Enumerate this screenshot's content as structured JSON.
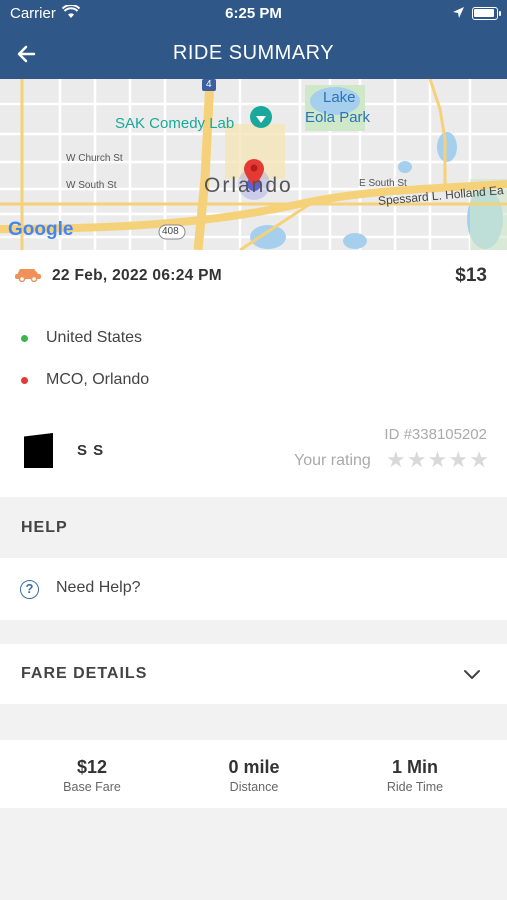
{
  "status_bar": {
    "carrier": "Carrier",
    "time": "6:25 PM"
  },
  "nav": {
    "title": "RIDE SUMMARY",
    "back_icon": "back-arrow-icon"
  },
  "map": {
    "labels": {
      "lake": "Lake",
      "eola_park": "Eola Park",
      "sak": "SAK Comedy Lab",
      "church": "W Church St",
      "south": "W South St",
      "e_south": "E South St",
      "orlando": "Orlando",
      "spessard": "Spessard L. Holland Ea",
      "route_408": "408",
      "route_4": "4",
      "google": "Google"
    }
  },
  "ride": {
    "date": "22 Feb, 2022 06:24 PM",
    "price": "$13",
    "pickup": "United States",
    "dropoff": "MCO, Orlando",
    "driver_name": "S S",
    "ride_id": "ID #338105202",
    "rating_label": "Your rating",
    "rating": 0,
    "colors": {
      "pickup_dot": "#3cb54a",
      "dropoff_dot": "#e53935",
      "header": "#2f5788"
    }
  },
  "help": {
    "section_title": "HELP",
    "need_help": "Need Help?"
  },
  "fare": {
    "section_title": "FARE DETAILS"
  },
  "stats": [
    {
      "value": "$12",
      "label": "Base Fare"
    },
    {
      "value": "0 mile",
      "label": "Distance"
    },
    {
      "value": "1 Min",
      "label": "Ride Time"
    }
  ]
}
